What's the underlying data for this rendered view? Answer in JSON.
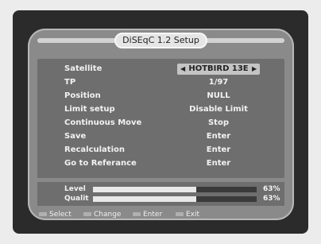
{
  "title": "DiSEqC 1.2 Setup",
  "menu": [
    {
      "label": "Satellite",
      "value": "HOTBIRD 13E",
      "selected": true
    },
    {
      "label": "TP",
      "value": "1/97"
    },
    {
      "label": "Position",
      "value": "NULL"
    },
    {
      "label": "Limit setup",
      "value": "Disable Limit"
    },
    {
      "label": "Continuous Move",
      "value": "Stop"
    },
    {
      "label": "Save",
      "value": "Enter"
    },
    {
      "label": "Recalculation",
      "value": "Enter"
    },
    {
      "label": "Go to Referance",
      "value": "Enter"
    }
  ],
  "signal": {
    "level": {
      "label": "Level",
      "value_text": "63%",
      "fraction": 0.63
    },
    "quality": {
      "label": "Qualit",
      "value_text": "63%",
      "fraction": 0.63
    }
  },
  "footer": {
    "select": "Select",
    "change": "Change",
    "enter": "Enter",
    "exit": "Exit"
  },
  "icons": {
    "left_arrow": "left-arrow-icon",
    "right_arrow": "right-arrow-icon"
  }
}
